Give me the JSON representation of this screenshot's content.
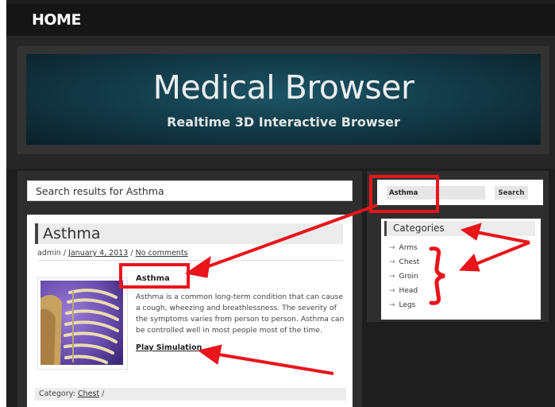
{
  "nav": {
    "home": "HOME"
  },
  "banner": {
    "title": "Medical Browser",
    "subtitle": "Realtime 3D Interactive Browser"
  },
  "search_results": {
    "heading": "Search results for Asthma"
  },
  "post": {
    "title": "Asthma",
    "author": "admin",
    "date": "January 4, 2013",
    "comments": "No comments",
    "entry_title": "Asthma",
    "entry_text": "Asthma is a common long-term condition that can cause a cough, wheezing and breathlessness. The severity of the symptoms varies from person to person. Asthma can be controlled well in most people most of the time.",
    "play_link": "Play Simulation",
    "category_label": "Category:",
    "category": "Chest"
  },
  "sidebar": {
    "search_value": "Asthma",
    "search_button": "Search",
    "categories_title": "Categories",
    "categories": [
      {
        "label": "Arms"
      },
      {
        "label": "Chest"
      },
      {
        "label": "Groin"
      },
      {
        "label": "Head"
      },
      {
        "label": "Legs"
      }
    ]
  },
  "colors": {
    "annotation": "#e8151b",
    "banner_teal": "#123744",
    "background": "#1e1e1e"
  },
  "icons": {
    "category_bullet": "arrow-right-icon",
    "thumbnail": "ribcage-image"
  }
}
